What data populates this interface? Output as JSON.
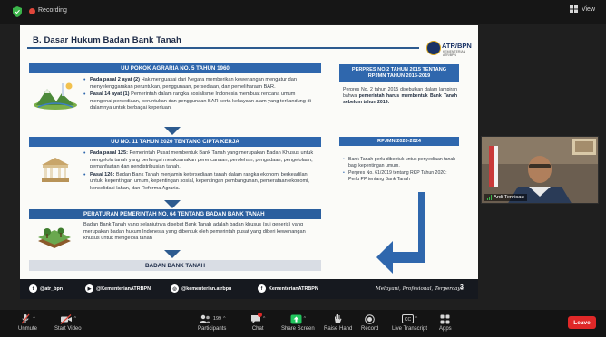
{
  "app": {
    "recording_label": "Recording",
    "view_label": "View"
  },
  "slide": {
    "title": "B. Dasar Hukum Badan Bank Tanah",
    "logo_text": "ATR/BPN",
    "logo_subtext": "KEMENTERIAN ATR/BPN",
    "blocks": [
      {
        "heading": "UU POKOK AGRARIA NO. 5 TAHUN 1960",
        "items": [
          {
            "bold": "Pada pasal 2 ayat (2)",
            "text": " Hak menguasai dari Negara memberikan kewenangan mengatur dan menyelenggarakan peruntukan, penggunaan, persediaan, dan pemeliharaan BAR."
          },
          {
            "bold": "Pasal 14 ayat (1)",
            "text": " Pemerintah dalam rangka sosialisme Indonesia membuat rencana umum mengenai persediaan, peruntukan dan penggunaan BAR serta kekayaan alam yang terkandung di dalamnya untuk berbagai keperluan."
          }
        ]
      },
      {
        "heading": "UU NO. 11 TAHUN 2020 TENTANG CIPTA KERJA",
        "items": [
          {
            "bold": "Pada pasal 125:",
            "text": " Pemerintah Pusat membentuk Bank Tanah yang merupakan Badan Khusus untuk mengelola tanah yang berfungsi melaksanakan perencanaan, perolehan, pengadaan, pengelolaan, pemanfaatan dan pendistribusian tanah."
          },
          {
            "bold": "Pasal 126:",
            "text": " Badan Bank Tanah menjamin ketersediaan tanah dalam rangka ekonomi berkeadilan untuk: kepentingan umum, kepentingan sosial, kepentingan pembangunan, pemerataan ekonomi, konsolidasi lahan, dan Reforma Agraria."
          }
        ]
      },
      {
        "heading": "PERATURAN PEMERINTAH NO. 64 TENTANG BADAN BANK TANAH",
        "paragraph": "Badan Bank Tanah yang selanjutnya disebut Bank Tanah adalah badan khusus (sui generis) yang merupakan badan hukum Indonesia yang dibentuk oleh pemerintah pusat yang diberi kewenangan khusus untuk mengelola tanah"
      }
    ],
    "final_label": "BADAN BANK TANAH",
    "panels": [
      {
        "heading_line1": "PERPRES NO.2 TAHUN 2015 TENTANG",
        "heading_line2": "RPJMN TAHUN 2015-2019",
        "body_pre": "Perpres No. 2 tahun 2015 disebutkan dalam lampiran bahwa ",
        "body_bold": "pemerintah harus membentuk Bank Tanah sebelum tahun 2019."
      },
      {
        "heading": "RPJMN 2020-2024",
        "items": [
          "Bank Tanah perlu dibentuk untuk penyediaan tanah bagi kepentingan umum.",
          "Perpres No. 61/2019 tentang RKP Tahun 2020: Perlu PP tentang Bank Tanah"
        ]
      }
    ],
    "footer": {
      "socials": [
        {
          "icon": "twitter-icon",
          "glyph": "t",
          "handle": "@atr_bpn"
        },
        {
          "icon": "youtube-icon",
          "glyph": "▶",
          "handle": "@KementerianATRBPN"
        },
        {
          "icon": "instagram-icon",
          "glyph": "◎",
          "handle": "@kementerian.atrbpn"
        },
        {
          "icon": "facebook-icon",
          "glyph": "f",
          "handle": "KementerianATRBPN"
        }
      ],
      "tagline": "Melayani, Profesional, Terpercaya",
      "page_number": "3"
    }
  },
  "participant": {
    "name": "Ardi Tenrisau"
  },
  "toolbar": {
    "items": [
      {
        "icon": "microphone-muted-icon",
        "label": "Unmute"
      },
      {
        "icon": "video-camera-off-icon",
        "label": "Start Video"
      },
      {
        "icon": "participants-icon",
        "label": "Participants",
        "count": "199"
      },
      {
        "icon": "chat-icon",
        "label": "Chat"
      },
      {
        "icon": "share-screen-icon",
        "label": "Share Screen"
      },
      {
        "icon": "raise-hand-icon",
        "label": "Raise Hand"
      },
      {
        "icon": "record-icon",
        "label": "Record"
      },
      {
        "icon": "live-transcript-icon",
        "label": "Live Transcript"
      },
      {
        "icon": "apps-icon",
        "label": "Apps"
      }
    ],
    "leave_label": "Leave",
    "colors": {
      "share_accent": "#22c55e",
      "leave": "#e02828"
    }
  }
}
